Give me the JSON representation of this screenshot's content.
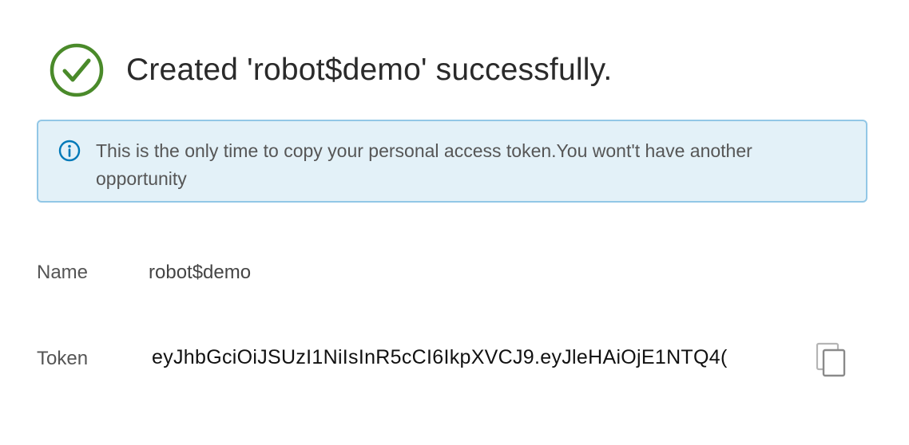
{
  "header": {
    "title": "Created 'robot$demo' successfully.",
    "icon": "check-circle-icon",
    "icon_color": "#4a8a2a"
  },
  "alert": {
    "icon": "info-icon",
    "message": "This is the only time to copy your personal access token.You wont't have another opportunity",
    "background": "#e3f1f8",
    "border_color": "#92c7e6",
    "icon_color": "#0079b8"
  },
  "details": {
    "name_label": "Name",
    "name_value": "robot$demo",
    "token_label": "Token",
    "token_value": "eyJhbGciOiJSUzI1NiIsInR5cCI6IkpXVCJ9.eyJleHAiOjE1NTQ4(",
    "copy_icon": "copy-icon"
  }
}
